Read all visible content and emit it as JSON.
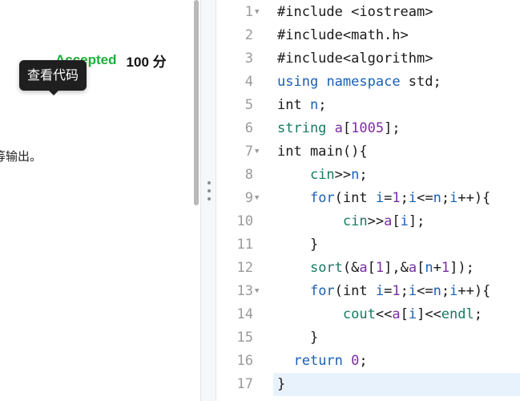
{
  "left": {
    "status": "Accepted",
    "score": "100 分",
    "tooltip": "查看代码",
    "desc_fragment": "等输出。"
  },
  "editor": {
    "lines": [
      {
        "n": "1",
        "fold": true,
        "tokens": [
          {
            "t": "#include <iostream>",
            "c": "plain"
          }
        ]
      },
      {
        "n": "2",
        "fold": false,
        "tokens": [
          {
            "t": "#include<math.h>",
            "c": "plain"
          }
        ]
      },
      {
        "n": "3",
        "fold": false,
        "tokens": [
          {
            "t": "#include<algorithm>",
            "c": "plain"
          }
        ]
      },
      {
        "n": "4",
        "fold": false,
        "tokens": [
          {
            "t": "using",
            "c": "kw"
          },
          {
            "t": " ",
            "c": "plain"
          },
          {
            "t": "namespace",
            "c": "kw"
          },
          {
            "t": " std;",
            "c": "plain"
          }
        ]
      },
      {
        "n": "5",
        "fold": false,
        "tokens": [
          {
            "t": "int",
            "c": "plain"
          },
          {
            "t": " ",
            "c": "plain"
          },
          {
            "t": "n",
            "c": "kw"
          },
          {
            "t": ";",
            "c": "plain"
          }
        ]
      },
      {
        "n": "6",
        "fold": false,
        "tokens": [
          {
            "t": "string",
            "c": "fn"
          },
          {
            "t": " ",
            "c": "plain"
          },
          {
            "t": "a",
            "c": "var"
          },
          {
            "t": "[",
            "c": "plain"
          },
          {
            "t": "1005",
            "c": "num"
          },
          {
            "t": "];",
            "c": "plain"
          }
        ]
      },
      {
        "n": "7",
        "fold": true,
        "tokens": [
          {
            "t": "int main(){",
            "c": "plain"
          }
        ]
      },
      {
        "n": "8",
        "fold": false,
        "tokens": [
          {
            "t": "    ",
            "c": "plain"
          },
          {
            "t": "cin",
            "c": "fn"
          },
          {
            "t": ">>",
            "c": "plain"
          },
          {
            "t": "n",
            "c": "kw"
          },
          {
            "t": ";",
            "c": "plain"
          }
        ]
      },
      {
        "n": "9",
        "fold": true,
        "tokens": [
          {
            "t": "    ",
            "c": "plain"
          },
          {
            "t": "for",
            "c": "kw"
          },
          {
            "t": "(int ",
            "c": "plain"
          },
          {
            "t": "i",
            "c": "kw"
          },
          {
            "t": "=",
            "c": "plain"
          },
          {
            "t": "1",
            "c": "num"
          },
          {
            "t": ";",
            "c": "plain"
          },
          {
            "t": "i",
            "c": "kw"
          },
          {
            "t": "<=",
            "c": "plain"
          },
          {
            "t": "n",
            "c": "kw"
          },
          {
            "t": ";",
            "c": "plain"
          },
          {
            "t": "i",
            "c": "kw"
          },
          {
            "t": "++){",
            "c": "plain"
          }
        ]
      },
      {
        "n": "10",
        "fold": false,
        "tokens": [
          {
            "t": "        ",
            "c": "plain"
          },
          {
            "t": "cin",
            "c": "fn"
          },
          {
            "t": ">>",
            "c": "plain"
          },
          {
            "t": "a",
            "c": "var"
          },
          {
            "t": "[",
            "c": "plain"
          },
          {
            "t": "i",
            "c": "kw"
          },
          {
            "t": "];",
            "c": "plain"
          }
        ]
      },
      {
        "n": "11",
        "fold": false,
        "tokens": [
          {
            "t": "    }",
            "c": "plain"
          }
        ]
      },
      {
        "n": "12",
        "fold": false,
        "tokens": [
          {
            "t": "    ",
            "c": "plain"
          },
          {
            "t": "sort",
            "c": "fn"
          },
          {
            "t": "(&",
            "c": "plain"
          },
          {
            "t": "a",
            "c": "var"
          },
          {
            "t": "[",
            "c": "plain"
          },
          {
            "t": "1",
            "c": "num"
          },
          {
            "t": "],&",
            "c": "plain"
          },
          {
            "t": "a",
            "c": "var"
          },
          {
            "t": "[",
            "c": "plain"
          },
          {
            "t": "n",
            "c": "kw"
          },
          {
            "t": "+",
            "c": "plain"
          },
          {
            "t": "1",
            "c": "num"
          },
          {
            "t": "]);",
            "c": "plain"
          }
        ]
      },
      {
        "n": "13",
        "fold": true,
        "tokens": [
          {
            "t": "    ",
            "c": "plain"
          },
          {
            "t": "for",
            "c": "kw"
          },
          {
            "t": "(int ",
            "c": "plain"
          },
          {
            "t": "i",
            "c": "kw"
          },
          {
            "t": "=",
            "c": "plain"
          },
          {
            "t": "1",
            "c": "num"
          },
          {
            "t": ";",
            "c": "plain"
          },
          {
            "t": "i",
            "c": "kw"
          },
          {
            "t": "<=",
            "c": "plain"
          },
          {
            "t": "n",
            "c": "kw"
          },
          {
            "t": ";",
            "c": "plain"
          },
          {
            "t": "i",
            "c": "kw"
          },
          {
            "t": "++){",
            "c": "plain"
          }
        ]
      },
      {
        "n": "14",
        "fold": false,
        "tokens": [
          {
            "t": "        ",
            "c": "plain"
          },
          {
            "t": "cout",
            "c": "fn"
          },
          {
            "t": "<<",
            "c": "plain"
          },
          {
            "t": "a",
            "c": "var"
          },
          {
            "t": "[",
            "c": "plain"
          },
          {
            "t": "i",
            "c": "kw"
          },
          {
            "t": "]<<",
            "c": "plain"
          },
          {
            "t": "endl",
            "c": "fn"
          },
          {
            "t": ";",
            "c": "plain"
          }
        ]
      },
      {
        "n": "15",
        "fold": false,
        "tokens": [
          {
            "t": "    }",
            "c": "plain"
          }
        ]
      },
      {
        "n": "16",
        "fold": false,
        "tokens": [
          {
            "t": "  ",
            "c": "plain"
          },
          {
            "t": "return",
            "c": "kw"
          },
          {
            "t": " ",
            "c": "plain"
          },
          {
            "t": "0",
            "c": "num"
          },
          {
            "t": ";",
            "c": "plain"
          }
        ]
      },
      {
        "n": "17",
        "fold": false,
        "active": true,
        "tokens": [
          {
            "t": "}",
            "c": "plain"
          }
        ]
      }
    ]
  },
  "colors": {
    "accepted": "#1db13a",
    "keyword": "#1a5fb4",
    "function": "#167a65",
    "number": "#7a2ea0",
    "active_line": "#e8f2fd"
  },
  "icons": {
    "fold": "chevron-down-icon",
    "splitter": "drag-handle-icon"
  }
}
